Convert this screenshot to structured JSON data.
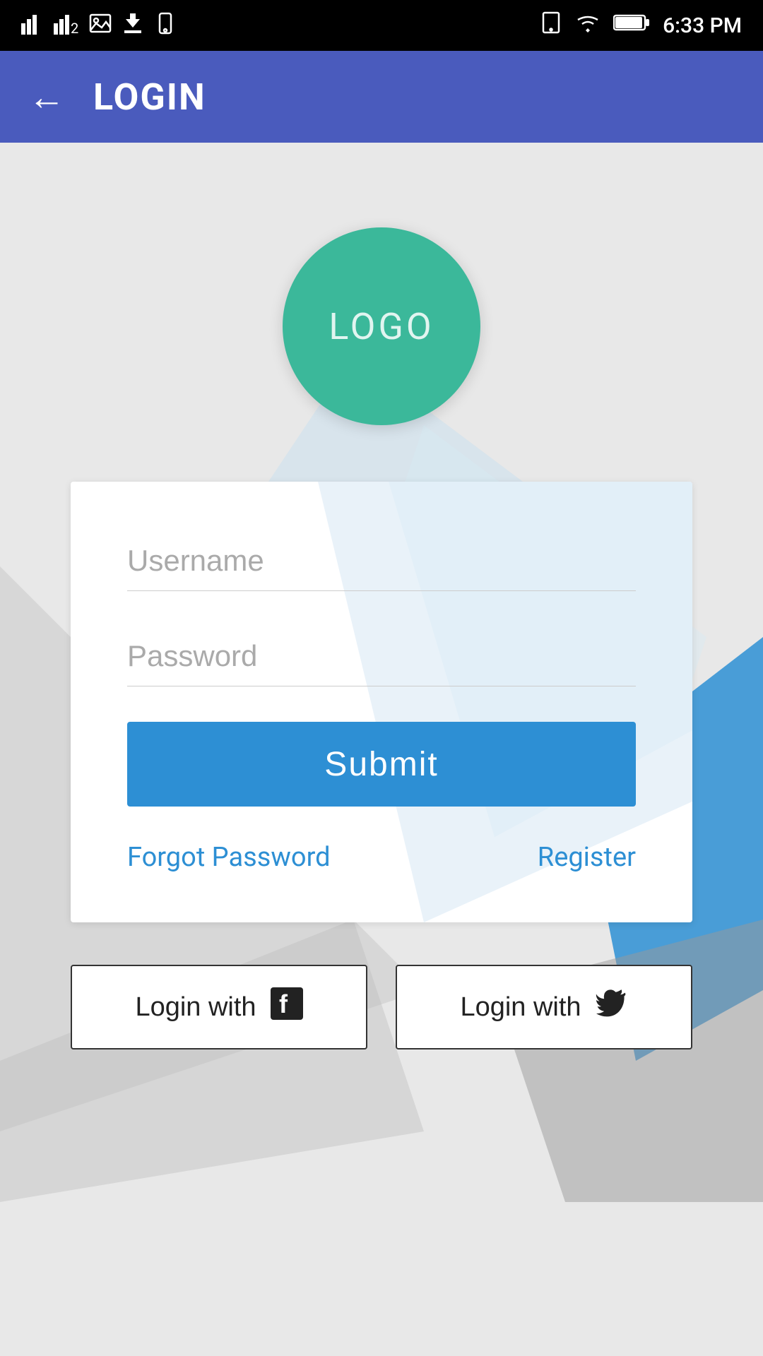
{
  "statusBar": {
    "time": "6:33 PM",
    "icons": {
      "signal1": "signal-icon",
      "signal2": "signal2-icon",
      "gallery": "gallery-icon",
      "download": "download-icon",
      "phone": "phone-icon",
      "tablet": "tablet-icon",
      "wifi": "wifi-icon",
      "battery": "battery-icon"
    }
  },
  "header": {
    "backLabel": "←",
    "title": "LOGIN"
  },
  "logo": {
    "text": "LOGO",
    "bgColor": "#3bb89a"
  },
  "form": {
    "usernameLabel": "Username",
    "usernamePlaceholder": "Username",
    "passwordLabel": "Password",
    "passwordPlaceholder": "Password",
    "submitLabel": "Submit",
    "forgotPasswordLabel": "Forgot Password",
    "registerLabel": "Register"
  },
  "social": {
    "facebookLabel": "Login with",
    "twitterLabel": "Login with",
    "facebookIcon": "facebook-icon",
    "twitterIcon": "twitter-icon"
  }
}
